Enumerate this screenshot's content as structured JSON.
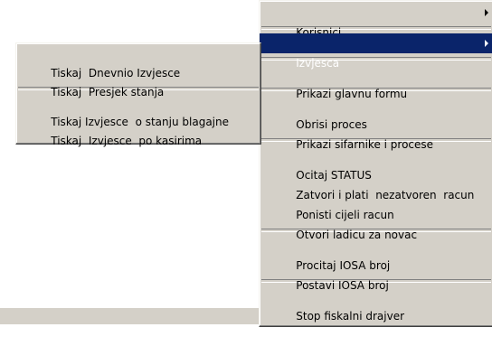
{
  "main_menu": {
    "korisnici": "Korisnici",
    "izvjesca": "Izvjesca",
    "prikazi_glavnu_formu": "Prikazi glavnu formu",
    "obrisi_proces": "Obrisi proces",
    "prikazi_sifarnike": "Prikazi sifarnike i procese",
    "ocitaj_status": "Ocitaj STATUS",
    "zatvori_i_platit": "Zatvori i plati  nezatvoren  racun",
    "ponisti_racun": "Ponisti cijeli racun",
    "otvori_ladicu": "Otvori ladicu za novac",
    "procitaj_iosa": "Procitaj IOSA broj",
    "postavi_iosa": "Postavi IOSA broj",
    "stop_fiskalni": "Stop fiskalni drajver"
  },
  "submenu": {
    "dnevno_izvjesce": "Tiskaj  Dnevnio Izvjesce",
    "presjek_stanja": "Tiskaj  Presjek stanja",
    "stanje_blagajne": "Tiskaj Izvjesce  o stanju blagajne",
    "po_kasirima": "Tiskaj  Izvjesce  po kasirima"
  },
  "colors": {
    "menu_face": "#d4d0c8",
    "highlight": "#0a246a",
    "highlight_text": "#ffffff"
  },
  "icons": {
    "submenu_arrow": "submenu-arrow-icon"
  }
}
